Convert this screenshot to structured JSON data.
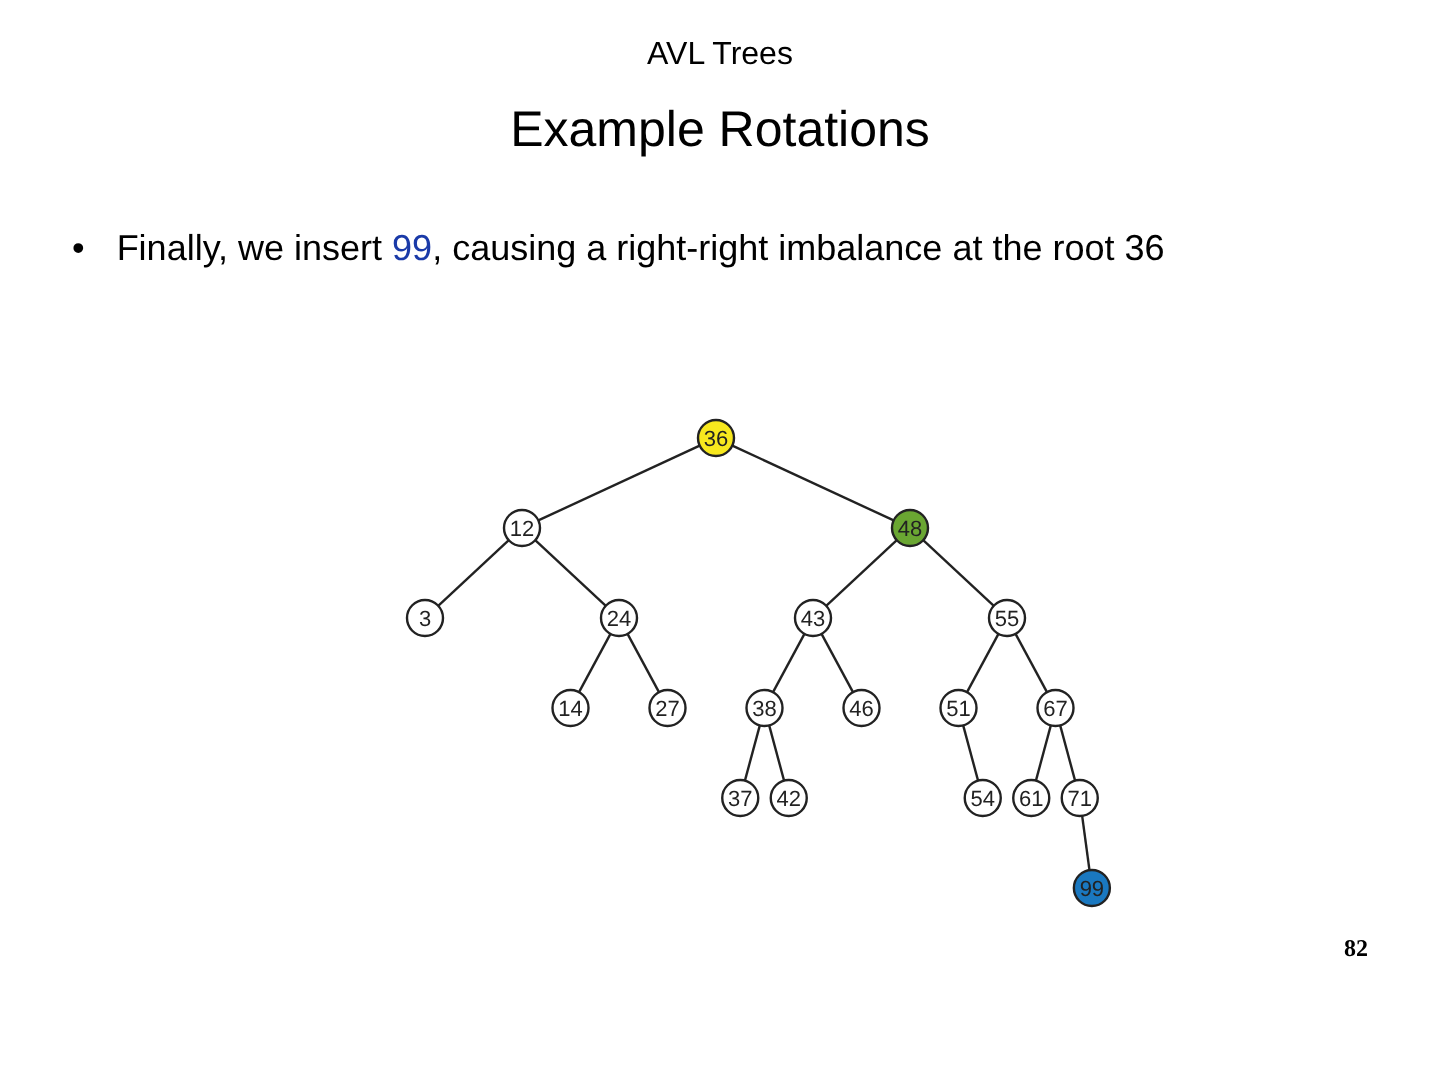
{
  "header": {
    "title": "AVL Trees",
    "subtitle": "Example Rotations"
  },
  "bullet": {
    "marker": "•",
    "parts": [
      {
        "text": "Finally, we insert ",
        "highlight": false
      },
      {
        "text": "99",
        "highlight": true
      },
      {
        "text": ", causing a right-right imbalance at the root 36",
        "highlight": false
      }
    ]
  },
  "tree": {
    "root": {
      "label": "36",
      "color": "#f7e81e",
      "children": [
        {
          "label": "12",
          "kind": "left",
          "color": "#ffffff",
          "children": [
            {
              "label": "3",
              "kind": "left",
              "color": "#ffffff"
            },
            {
              "label": "24",
              "kind": "right",
              "color": "#ffffff",
              "children": [
                {
                  "label": "14",
                  "kind": "left",
                  "color": "#ffffff"
                },
                {
                  "label": "27",
                  "kind": "right",
                  "color": "#ffffff"
                }
              ]
            }
          ]
        },
        {
          "label": "48",
          "kind": "right",
          "color": "#6aa632",
          "children": [
            {
              "label": "43",
              "kind": "left",
              "color": "#ffffff",
              "children": [
                {
                  "label": "38",
                  "kind": "left",
                  "color": "#ffffff",
                  "children": [
                    {
                      "label": "37",
                      "kind": "left",
                      "color": "#ffffff"
                    },
                    {
                      "label": "42",
                      "kind": "right",
                      "color": "#ffffff"
                    }
                  ]
                },
                {
                  "label": "46",
                  "kind": "right",
                  "color": "#ffffff"
                }
              ]
            },
            {
              "label": "55",
              "kind": "right",
              "color": "#ffffff",
              "children": [
                {
                  "label": "51",
                  "kind": "left",
                  "color": "#ffffff",
                  "children": [
                    {
                      "label": "54",
                      "kind": "right",
                      "color": "#ffffff"
                    }
                  ]
                },
                {
                  "label": "67",
                  "kind": "right",
                  "color": "#ffffff",
                  "children": [
                    {
                      "label": "61",
                      "kind": "left",
                      "color": "#ffffff"
                    },
                    {
                      "label": "71",
                      "kind": "right",
                      "color": "#ffffff",
                      "children": [
                        {
                          "label": "99",
                          "kind": "right",
                          "color": "#1a78c0"
                        }
                      ]
                    }
                  ]
                }
              ]
            }
          ]
        }
      ]
    }
  },
  "footer": {
    "page_number": "82"
  }
}
